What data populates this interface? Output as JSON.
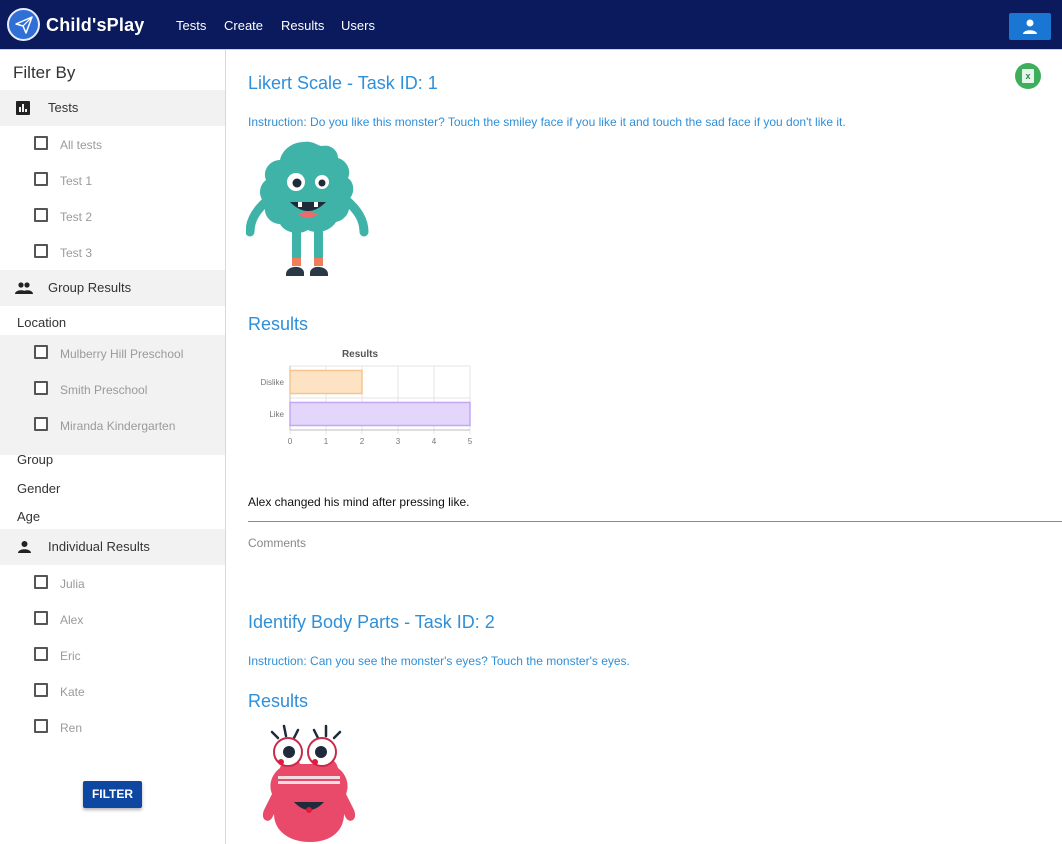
{
  "app": {
    "brand": "Child'sPlay",
    "accent": "#0a1a5c"
  },
  "nav": {
    "items": [
      "Tests",
      "Create",
      "Results",
      "Users"
    ]
  },
  "sidebar": {
    "title": "Filter By",
    "tests_section": {
      "label": "Tests",
      "options": [
        "All tests",
        "Test 1",
        "Test 2",
        "Test 3"
      ]
    },
    "group_section": {
      "label": "Group Results",
      "location_label": "Location",
      "locations": [
        "Mulberry Hill Preschool",
        "Smith Preschool",
        "Miranda Kindergarten"
      ],
      "group_label": "Group",
      "gender_label": "Gender",
      "age_label": "Age"
    },
    "individual_section": {
      "label": "Individual Results",
      "people": [
        "Julia",
        "Alex",
        "Eric",
        "Kate",
        "Ren"
      ]
    },
    "filter_button": "FILTER"
  },
  "main": {
    "task1": {
      "title": "Likert Scale - Task ID: 1",
      "instruction": "Instruction: Do you like this monster? Touch the smiley face if you like it and touch the sad face if you don't like it.",
      "results_heading": "Results",
      "note": "Alex changed his mind after pressing like.",
      "comments_label": "Comments"
    },
    "task2": {
      "title": "Identify Body Parts - Task ID: 2",
      "instruction": "Instruction: Can you see the monster's eyes? Touch the monster's eyes.",
      "results_heading": "Results"
    }
  },
  "chart_data": {
    "type": "bar",
    "orientation": "horizontal",
    "title": "Results",
    "categories": [
      "Dislike",
      "Like"
    ],
    "values": [
      2,
      5
    ],
    "xlim": [
      0,
      5
    ],
    "xticks": [
      "0",
      "1",
      "2",
      "3",
      "4",
      "5"
    ],
    "colors": [
      "#fde3c4",
      "#e3d6fb"
    ],
    "border_colors": [
      "#f6c48f",
      "#c4a6f3"
    ],
    "grid": true
  }
}
